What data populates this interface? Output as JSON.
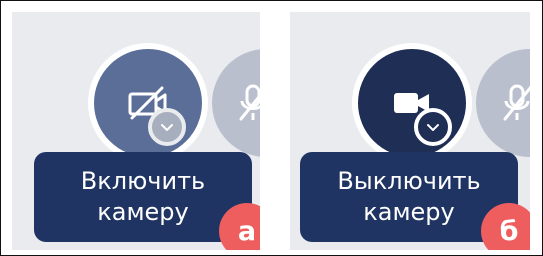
{
  "colors": {
    "panel_bg": "#e9ebef",
    "camera_off_bg": "#5b6e98",
    "camera_on_bg": "#1f2e55",
    "mic_bg": "#b9bfcd",
    "tooltip_bg": "#1f3463",
    "badge_bg": "#ee5e5e"
  },
  "panel_a": {
    "camera_icon": "camera-off-icon",
    "mic_icon": "mic-off-icon",
    "dropdown_icon": "chevron-down-icon",
    "tooltip": {
      "line1": "Включить",
      "line2": "камеру"
    },
    "badge": "а"
  },
  "panel_b": {
    "camera_icon": "camera-icon",
    "mic_icon": "mic-off-icon",
    "dropdown_icon": "chevron-down-icon",
    "tooltip": {
      "line1": "Выключить",
      "line2": "камеру"
    },
    "badge": "б"
  }
}
